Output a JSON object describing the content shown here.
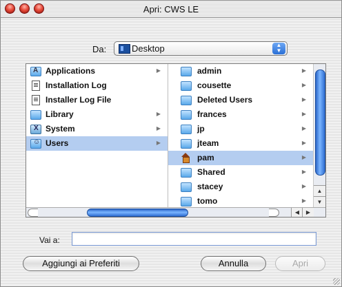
{
  "window": {
    "title": "Apri: CWS LE",
    "traffic_light_color": "#e84c3c"
  },
  "location": {
    "label": "Da:",
    "value": "Desktop"
  },
  "column1": [
    {
      "label": "Applications",
      "icon": "applications-folder-icon",
      "has_children": true,
      "selected": false
    },
    {
      "label": "Installation Log",
      "icon": "document-icon",
      "has_children": false,
      "selected": false
    },
    {
      "label": "Installer Log File",
      "icon": "document-icon",
      "has_children": false,
      "selected": false
    },
    {
      "label": "Library",
      "icon": "folder-icon",
      "has_children": true,
      "selected": false
    },
    {
      "label": "System",
      "icon": "system-folder-icon",
      "has_children": true,
      "selected": false
    },
    {
      "label": "Users",
      "icon": "users-folder-icon",
      "has_children": true,
      "selected": true
    }
  ],
  "column2": [
    {
      "label": "admin",
      "icon": "folder-icon",
      "has_children": true,
      "selected": false
    },
    {
      "label": "cousette",
      "icon": "folder-icon",
      "has_children": true,
      "selected": false
    },
    {
      "label": "Deleted Users",
      "icon": "folder-icon",
      "has_children": true,
      "selected": false
    },
    {
      "label": "frances",
      "icon": "folder-icon",
      "has_children": true,
      "selected": false
    },
    {
      "label": "jp",
      "icon": "folder-icon",
      "has_children": true,
      "selected": false
    },
    {
      "label": "jteam",
      "icon": "folder-icon",
      "has_children": true,
      "selected": false
    },
    {
      "label": "pam",
      "icon": "home-icon",
      "has_children": true,
      "selected": true
    },
    {
      "label": "Shared",
      "icon": "folder-icon",
      "has_children": true,
      "selected": false
    },
    {
      "label": "stacey",
      "icon": "folder-icon",
      "has_children": true,
      "selected": false
    },
    {
      "label": "tomo",
      "icon": "folder-icon",
      "has_children": true,
      "selected": false
    }
  ],
  "goto": {
    "label": "Vai a:",
    "value": "",
    "placeholder": ""
  },
  "buttons": {
    "add_favorites": "Aggiungi ai Preferiti",
    "cancel": "Annulla",
    "open": "Apri"
  },
  "colors": {
    "selection": "#b4cdf0",
    "scroll_thumb": "#2b66c8"
  }
}
